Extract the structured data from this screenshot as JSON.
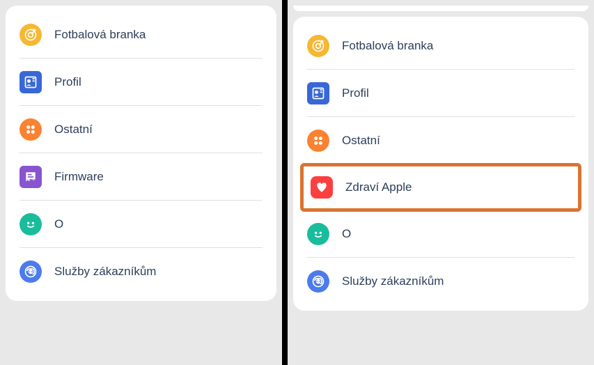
{
  "left_panel": {
    "items": [
      {
        "label": "Fotbalová branka",
        "icon": "target-icon"
      },
      {
        "label": "Profil",
        "icon": "profile-icon"
      },
      {
        "label": "Ostatní",
        "icon": "other-icon"
      },
      {
        "label": "Firmware",
        "icon": "firmware-icon"
      },
      {
        "label": "O",
        "icon": "about-icon"
      },
      {
        "label": "Služby zákazníkům",
        "icon": "support-icon"
      }
    ]
  },
  "right_panel": {
    "items": [
      {
        "label": "Fotbalová branka",
        "icon": "target-icon"
      },
      {
        "label": "Profil",
        "icon": "profile-icon"
      },
      {
        "label": "Ostatní",
        "icon": "other-icon"
      },
      {
        "label": "Zdraví Apple",
        "icon": "health-icon",
        "highlighted": true
      },
      {
        "label": "O",
        "icon": "about-icon"
      },
      {
        "label": "Služby zákazníkům",
        "icon": "support-icon"
      }
    ]
  },
  "colors": {
    "highlight_border": "#d97430",
    "target": "#f7b731",
    "profile": "#3867d6",
    "other": "#fa8231",
    "firmware": "#8854d0",
    "health": "#fc3f3f",
    "about": "#1abc9c",
    "support": "#4b7bec"
  }
}
